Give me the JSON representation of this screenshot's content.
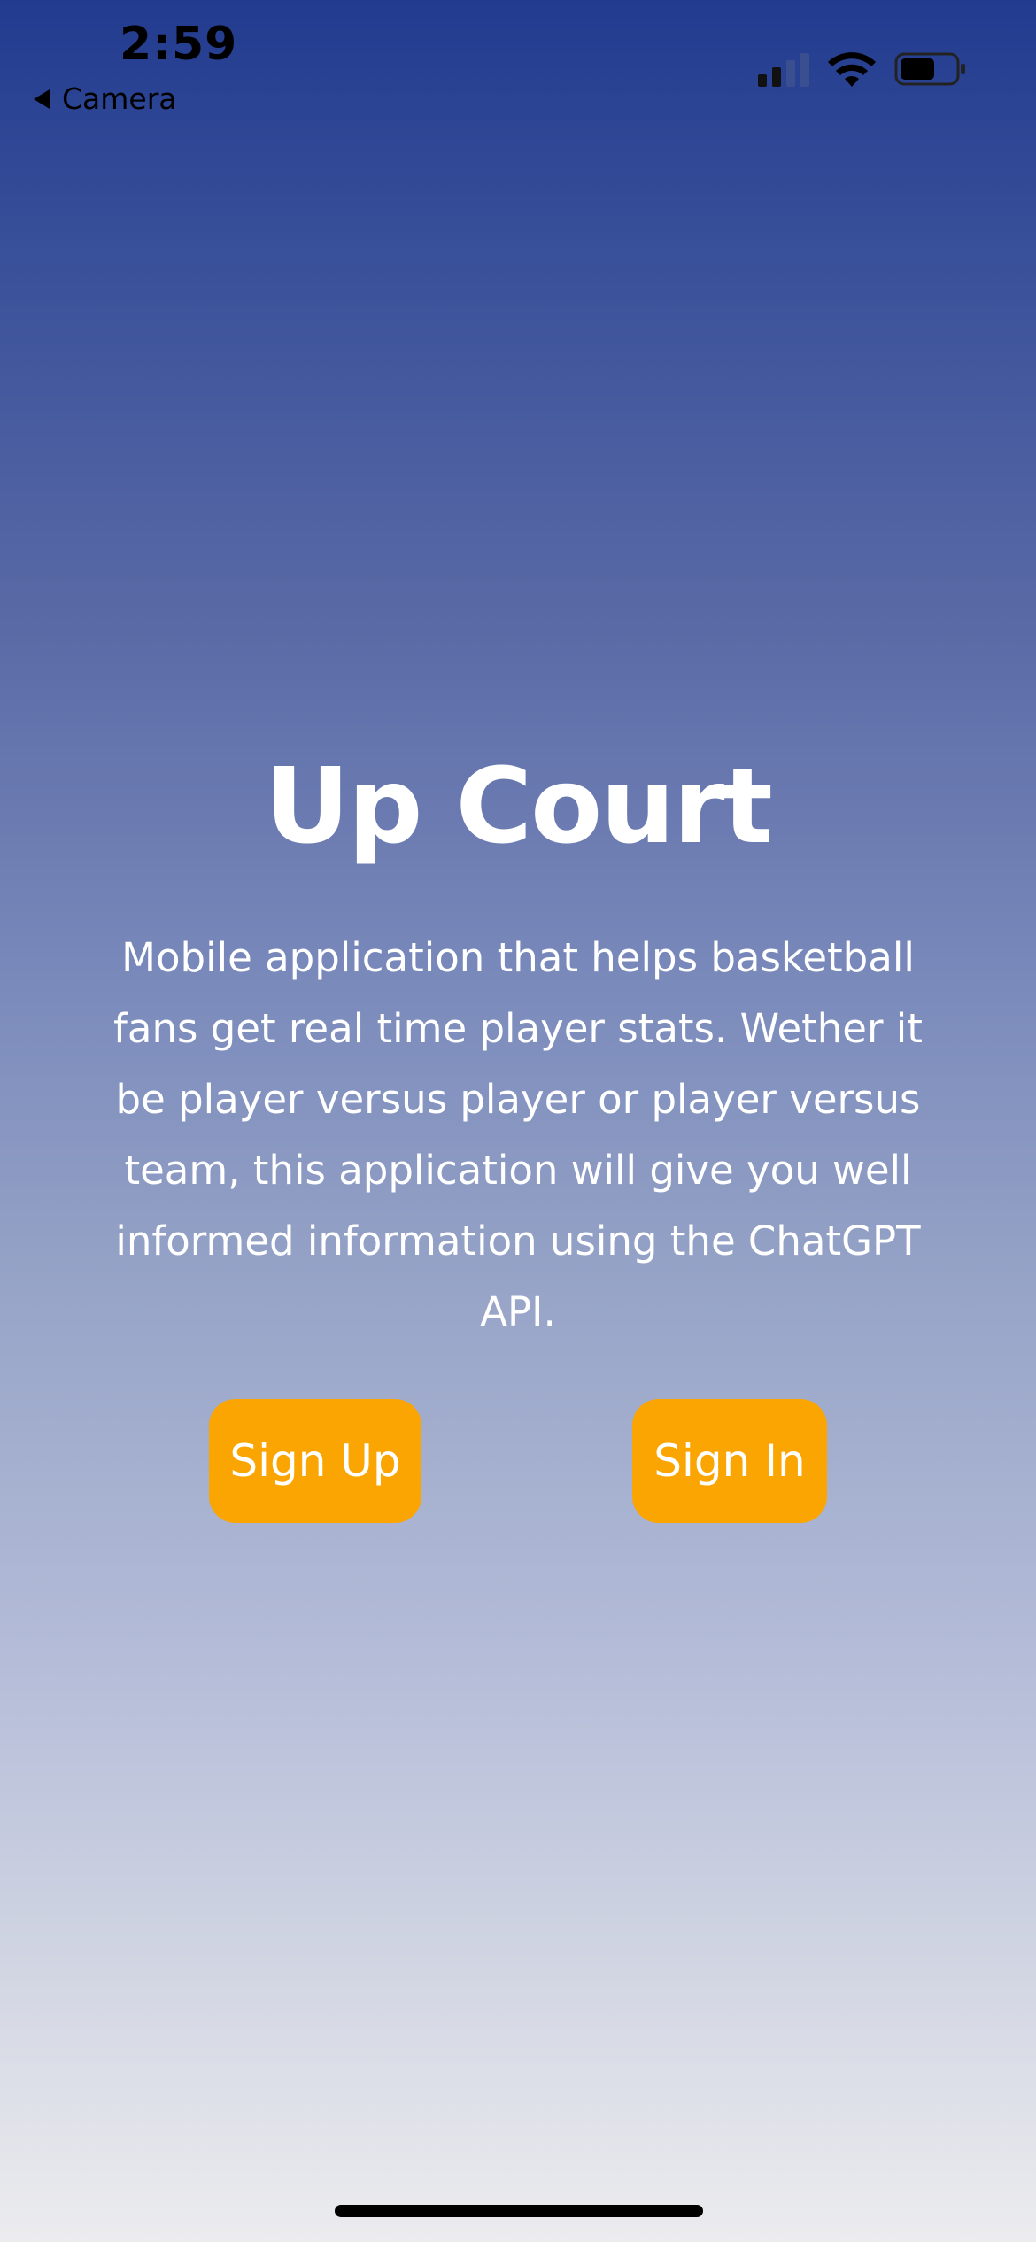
{
  "status_bar": {
    "time": "2:59",
    "back_label": "Camera",
    "icons": [
      "cellular-signal-icon",
      "wifi-icon",
      "battery-icon"
    ]
  },
  "hero": {
    "title": "Up Court",
    "description": "Mobile application that helps basketball fans get real time player stats. Wether it be player versus player or player versus team, this application will give you well informed information using the ChatGPT API."
  },
  "actions": {
    "sign_up_label": "Sign Up",
    "sign_in_label": "Sign In"
  },
  "colors": {
    "accent": "#fba503",
    "background_top": "#223b8f",
    "background_bottom": "#ececef",
    "text": "#ffffff"
  }
}
